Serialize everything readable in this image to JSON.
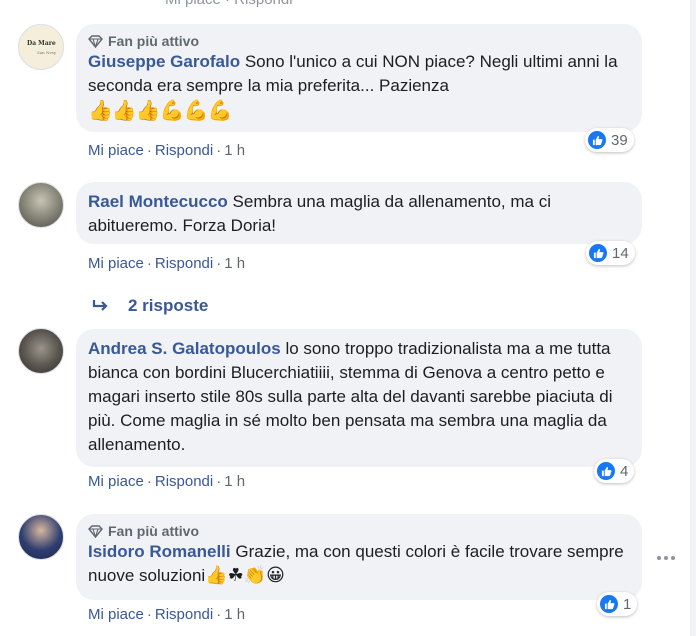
{
  "colors": {
    "link": "#385898",
    "bubble": "#f0f2f5",
    "like_blue": "#1877f2",
    "meta": "#606770"
  },
  "top_cut_text": "Mi piace · Rispondi",
  "replies_link": "2 risposte",
  "comments": [
    {
      "badge": "Fan più attivo",
      "avatar_text_1": "Da Mare",
      "avatar_text_2": "San Nesy",
      "author": "Giuseppe Garofalo",
      "text": "Sono l'unico a cui NON piace? Negli ultimi anni la seconda era sempre la mia preferita... Pazienza",
      "emojis": "👍👍👍💪💪💪",
      "reactions": "39",
      "like": "Mi piace",
      "reply": "Rispondi",
      "time": "1 h"
    },
    {
      "author": "Rael Montecucco",
      "text": "Sembra una maglia da allenamento, ma ci abitueremo. Forza Doria!",
      "reactions": "14",
      "like": "Mi piace",
      "reply": "Rispondi",
      "time": "1 h"
    },
    {
      "author": "Andrea S. Galatopoulos",
      "text": "lo sono troppo tradizionalista ma a me tutta bianca con bordini Blucerchiatiiii, stemma di Genova a centro petto e magari inserto stile 80s sulla parte alta del davanti sarebbe piaciuta di più. Come maglia in sé molto ben pensata ma sembra una maglia da allenamento.",
      "reactions": "4",
      "like": "Mi piace",
      "reply": "Rispondi",
      "time": "1 h"
    },
    {
      "badge": "Fan più attivo",
      "author": "Isidoro Romanelli",
      "text": "Grazie, ma con questi colori è facile trovare sempre nuove soluzioni",
      "emojis": "👍☘👏😀",
      "reactions": "1",
      "like": "Mi piace",
      "reply": "Rispondi",
      "time": "1 h"
    }
  ]
}
